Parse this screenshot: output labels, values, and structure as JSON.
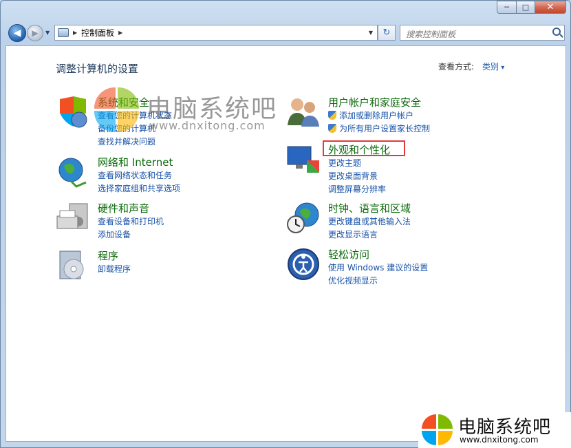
{
  "window": {
    "caption_min": "─",
    "caption_max": "□",
    "caption_close": "✕"
  },
  "nav": {
    "back_glyph": "◀",
    "forward_glyph": "▶",
    "dropdown_glyph": "▼",
    "refresh_glyph": "↻"
  },
  "address": {
    "crumb": "控制面板",
    "sep_glyph": "▶"
  },
  "search": {
    "placeholder": "搜索控制面板"
  },
  "page": {
    "title": "调整计算机的设置",
    "view_by_label": "查看方式:",
    "view_by_value": "类别"
  },
  "categories": {
    "system": {
      "title": "系统和安全",
      "links": [
        "查看您的计算机状态",
        "备份您的计算机",
        "查找并解决问题"
      ]
    },
    "network": {
      "title": "网络和 Internet",
      "links": [
        "查看网络状态和任务",
        "选择家庭组和共享选项"
      ]
    },
    "hardware": {
      "title": "硬件和声音",
      "links": [
        "查看设备和打印机",
        "添加设备"
      ]
    },
    "programs": {
      "title": "程序",
      "links": [
        "卸载程序"
      ]
    },
    "accounts": {
      "title": "用户帐户和家庭安全",
      "links": [
        "添加或删除用户帐户",
        "为所有用户设置家长控制"
      ]
    },
    "appearance": {
      "title": "外观和个性化",
      "links": [
        "更改主题",
        "更改桌面背景",
        "调整屏幕分辨率"
      ]
    },
    "clock": {
      "title": "时钟、语言和区域",
      "links": [
        "更改键盘或其他输入法",
        "更改显示语言"
      ]
    },
    "ease": {
      "title": "轻松访问",
      "links": [
        "使用 Windows 建议的设置",
        "优化视频显示"
      ]
    }
  },
  "watermark": {
    "name": "电脑系统吧",
    "url": "www.dnxitong.com"
  },
  "colors": {
    "link": "#1752a8",
    "category_title": "#0b6a0b",
    "highlight": "#e23a3a",
    "flag_red": "#f25022",
    "flag_green": "#7fba00",
    "flag_blue": "#00a4ef",
    "flag_yellow": "#ffb900"
  }
}
